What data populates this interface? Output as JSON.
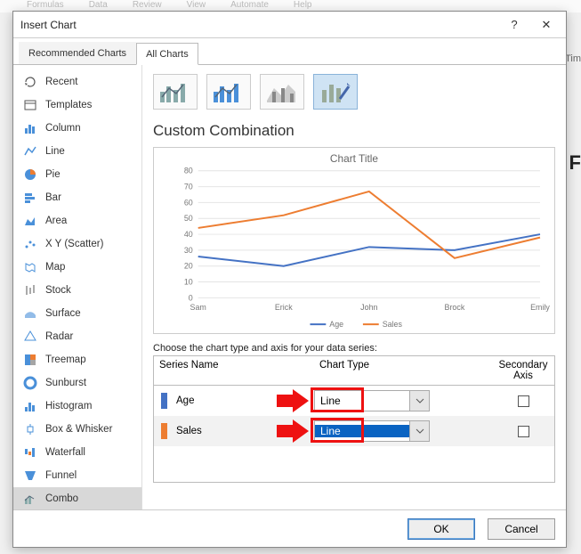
{
  "ghost_menu": [
    "Formulas",
    "Data",
    "Review",
    "View",
    "Automate",
    "Help"
  ],
  "frag_right1": "Tim",
  "frag_right2": "F",
  "dialog": {
    "title": "Insert Chart",
    "help_symbol": "?",
    "close_symbol": "✕",
    "tabs": {
      "recommended": "Recommended Charts",
      "all": "All Charts"
    },
    "sidebar": [
      "Recent",
      "Templates",
      "Column",
      "Line",
      "Pie",
      "Bar",
      "Area",
      "X Y (Scatter)",
      "Map",
      "Stock",
      "Surface",
      "Radar",
      "Treemap",
      "Sunburst",
      "Histogram",
      "Box & Whisker",
      "Waterfall",
      "Funnel",
      "Combo"
    ],
    "section_title": "Custom Combination",
    "instruction": "Choose the chart type and axis for your data series:",
    "grid_headers": {
      "name": "Series Name",
      "type": "Chart Type",
      "axis": "Secondary Axis"
    },
    "series_rows": [
      {
        "name": "Age",
        "type": "Line",
        "color": "#4472c4"
      },
      {
        "name": "Sales",
        "type": "Line",
        "color": "#ed7d31"
      }
    ],
    "buttons": {
      "ok": "OK",
      "cancel": "Cancel"
    }
  },
  "chart_data": {
    "type": "line",
    "title": "Chart Title",
    "xlabel": "",
    "ylabel": "",
    "ylim": [
      0,
      80
    ],
    "yticks": [
      0,
      10,
      20,
      30,
      40,
      50,
      60,
      70,
      80
    ],
    "categories": [
      "Sam",
      "Erick",
      "John",
      "Brock",
      "Emily"
    ],
    "series": [
      {
        "name": "Age",
        "color": "#4472c4",
        "values": [
          26,
          20,
          32,
          30,
          40
        ]
      },
      {
        "name": "Sales",
        "color": "#ed7d31",
        "values": [
          44,
          52,
          67,
          25,
          38
        ]
      }
    ],
    "legend_position": "bottom",
    "grid": true
  }
}
